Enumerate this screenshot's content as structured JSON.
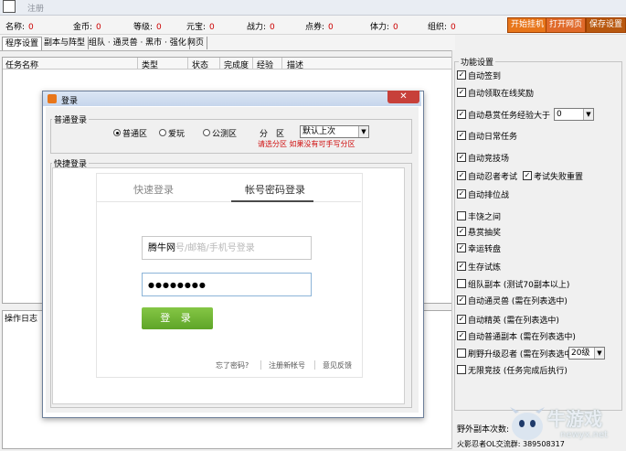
{
  "window": {
    "title": "注册"
  },
  "stats": [
    {
      "label": "名称:",
      "value": "0"
    },
    {
      "label": "金币:",
      "value": "0"
    },
    {
      "label": "等级:",
      "value": "0"
    },
    {
      "label": "元宝:",
      "value": "0"
    },
    {
      "label": "战力:",
      "value": "0"
    },
    {
      "label": "点券:",
      "value": "0"
    },
    {
      "label": "体力:",
      "value": "0"
    },
    {
      "label": "组织:",
      "value": "0"
    }
  ],
  "top_buttons": {
    "start": "开始挂机",
    "open_web": "打开网页",
    "save": "保存设置"
  },
  "tabs": [
    "程序设置",
    "副本与阵型",
    "组队 · 通灵兽 · 黑市 · 强化",
    "网页"
  ],
  "task_columns": [
    "任务名称",
    "类型",
    "状态",
    "完成度",
    "经验",
    "描述"
  ],
  "log_label": "操作日志",
  "features": {
    "title": "功能设置",
    "items": [
      {
        "label": "自动签到",
        "checked": true
      },
      {
        "label": "自动领取在线奖励",
        "checked": true
      },
      {
        "label": "自动悬赏任务",
        "checked": true,
        "extra_label": "经验大于",
        "select_value": "0"
      },
      {
        "label": "自动日常任务",
        "checked": true
      },
      {
        "label": "自动竞技场",
        "checked": true
      },
      {
        "label": "自动忍者考试",
        "checked": true,
        "extra_label": "考试失败重置",
        "extra_checked": true
      },
      {
        "label": "自动排位战",
        "checked": true
      },
      {
        "label": "丰饶之间",
        "checked": false
      },
      {
        "label": "悬赏抽奖",
        "checked": true
      },
      {
        "label": "幸运转盘",
        "checked": true
      },
      {
        "label": "生存试炼",
        "checked": true
      },
      {
        "label": "组队副本 (测试70副本以上)",
        "checked": false
      },
      {
        "label": "自动通灵兽 (需在列表选中)",
        "checked": true
      },
      {
        "label": "自动精英 (需在列表选中)",
        "checked": true
      },
      {
        "label": "自动普通副本 (需在列表选中)",
        "checked": true
      },
      {
        "label": "刷野升级忍者 (需在列表选中)",
        "checked": false,
        "select_value": "20级"
      },
      {
        "label": "无限竞技 (任务完成后执行)",
        "checked": false
      }
    ],
    "field_wild": "野外副本次数:",
    "footer": "火影忍者OL交流群: 389508317"
  },
  "dialog": {
    "title": "登录",
    "close": "✕",
    "normal_login": {
      "title": "普通登录",
      "radios": [
        {
          "label": "普通区",
          "checked": true
        },
        {
          "label": "爱玩",
          "checked": false
        },
        {
          "label": "公测区",
          "checked": false
        }
      ],
      "zone_label": "分　区",
      "zone_value": "默认上次",
      "hint": "请选分区 如果没有可手写分区"
    },
    "quick_login": {
      "title": "快捷登录",
      "tab_quick": "快速登录",
      "tab_account": "帐号密码登录",
      "username_prefix": "腾牛网",
      "username_placeholder": "号/邮箱/手机号登录",
      "password_mask": "●●●●●●●●",
      "login_button": "登 录",
      "links": [
        "忘了密码?",
        "注册新帐号",
        "意见反馈"
      ]
    }
  },
  "watermark": {
    "text": "牛游戏",
    "sub": "newyx.net"
  },
  "colors": {
    "accent_orange": "#e8761a",
    "login_green": "#5ea528",
    "hint_red": "#d01010"
  }
}
